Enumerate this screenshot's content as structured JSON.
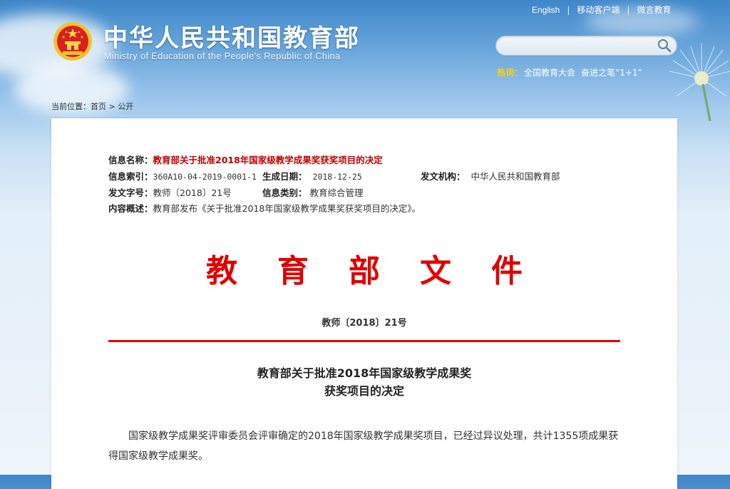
{
  "header": {
    "title_cn": "中华人民共和国教育部",
    "title_en": "Ministry of Education of the People's Republic of China",
    "links": [
      "English",
      "移动客户端",
      "微言教育"
    ],
    "hot_label": "热词：",
    "hot_items": [
      "全国教育大会",
      "奋进之笔“1+1”"
    ],
    "search_placeholder": ""
  },
  "breadcrumb": {
    "label": "当前位置：",
    "items": [
      "首页",
      "公开"
    ],
    "separator": ">"
  },
  "meta": {
    "name_label": "信息名称：",
    "name_value": "教育部关于批准2018年国家级教学成果奖获奖项目的决定",
    "index_label": "信息索引：",
    "index_value": "360A10-04-2019-0001-1",
    "date_label": "生成日期：",
    "date_value": "2018-12-25",
    "org_label": "发文机构：",
    "org_value": "中华人民共和国教育部",
    "docno_label": "发文字号：",
    "docno_value": "教师〔2018〕21号",
    "category_label": "信息类别：",
    "category_value": "教育综合管理",
    "summary_label": "内容概述：",
    "summary_value": "教育部发布《关于批准2018年国家级教学成果奖获奖项目的决定》。"
  },
  "document": {
    "heading": "教育部文件",
    "number": "教师〔2018〕21号",
    "title_line1": "教育部关于批准2018年国家级教学成果奖",
    "title_line2": "获奖项目的决定",
    "paragraph1": "国家级教学成果奖评审委员会评审确定的2018年国家级教学成果奖项目，已经过异议处理，共计1355项成果获得国家级教学成果奖。"
  },
  "colors": {
    "accent_red": "#e00000",
    "meta_red": "#c00000",
    "hot_yellow": "#ffd400",
    "sky_blue": "#3f86c9"
  }
}
